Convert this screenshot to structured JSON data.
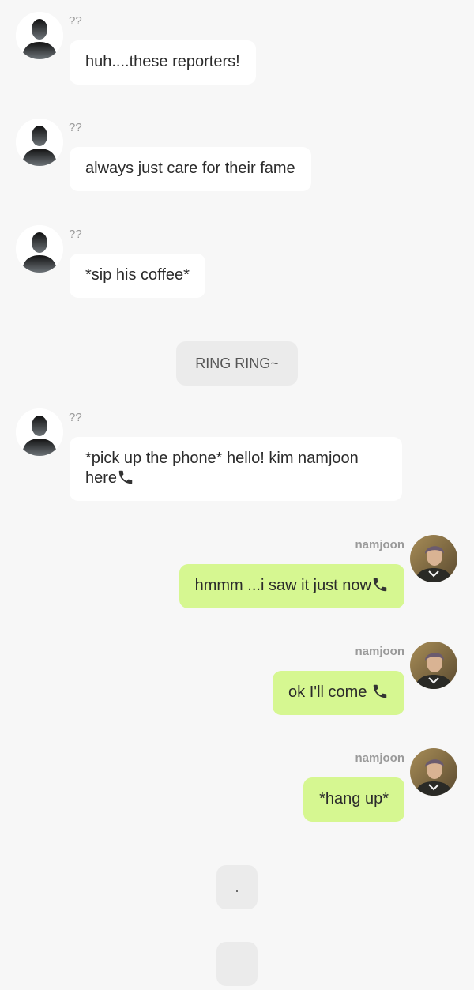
{
  "messages": [
    {
      "side": "left",
      "sender": "??",
      "text": "huh....these reporters!",
      "phone": false
    },
    {
      "side": "left",
      "sender": "??",
      "text": "always just care for their fame",
      "phone": false
    },
    {
      "side": "left",
      "sender": "??",
      "text": "*sip his coffee*",
      "phone": false
    },
    {
      "side": "left",
      "sender": "??",
      "text": "*pick up the phone* hello! kim namjoon here",
      "phone": true
    },
    {
      "side": "right",
      "sender": "namjoon",
      "text": "hmmm ...i saw it just now",
      "phone": true
    },
    {
      "side": "right",
      "sender": "namjoon",
      "text": "ok I'll come ",
      "phone": true
    },
    {
      "side": "right",
      "sender": "namjoon",
      "text": "*hang up*",
      "phone": false
    }
  ],
  "system": [
    {
      "text": "RING RING~"
    },
    {
      "text": "."
    },
    {
      "text": ""
    }
  ],
  "icons": {
    "unknown_avatar": "silhouette-avatar-icon",
    "namjoon_avatar": "profile-photo",
    "phone": "telephone-receiver-icon"
  },
  "colors": {
    "background": "#f7f7f7",
    "incoming_bubble": "#ffffff",
    "outgoing_bubble": "#d6f791",
    "system_bubble": "#ebebeb"
  }
}
